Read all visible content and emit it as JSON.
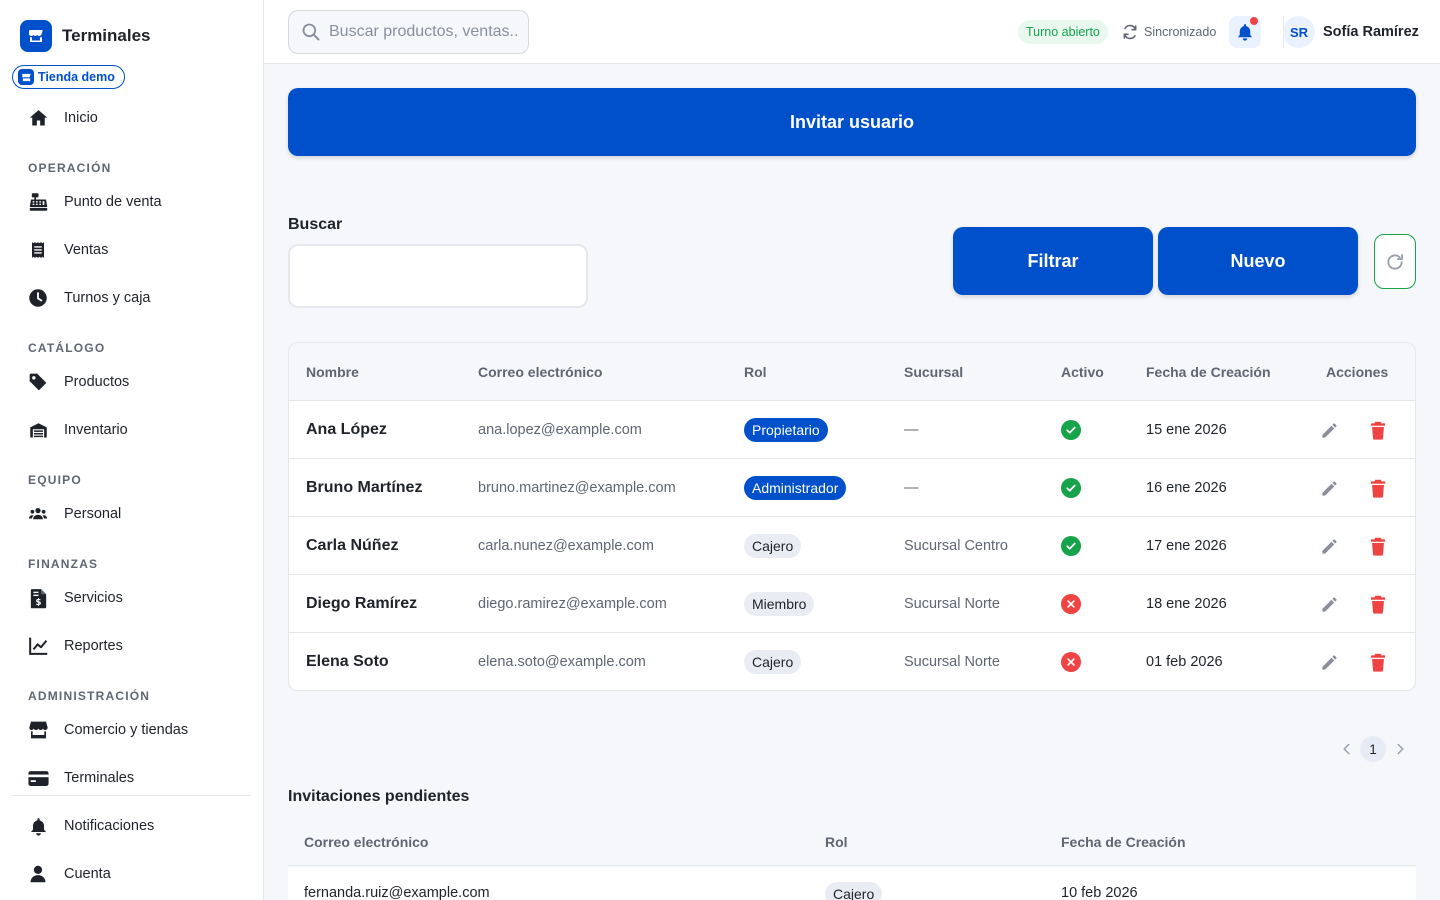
{
  "app": {
    "title": "Terminales",
    "store_badge": "Tienda demo"
  },
  "sidebar": {
    "home": "Inicio",
    "sections": {
      "operacion": "OPERACIÓN",
      "catalogo": "CATÁLOGO",
      "equipo": "EQUIPO",
      "finanzas": "FINANZAS",
      "administracion": "ADMINISTRACIÓN"
    },
    "items": {
      "pos": "Punto de venta",
      "ventas": "Ventas",
      "turnos": "Turnos y caja",
      "productos": "Productos",
      "inventario": "Inventario",
      "personal": "Personal",
      "servicios": "Servicios",
      "reportes": "Reportes",
      "comercio": "Comercio y tiendas",
      "terminales": "Terminales",
      "notificaciones": "Notificaciones",
      "cuenta": "Cuenta"
    }
  },
  "topbar": {
    "search_placeholder": "Buscar productos, ventas...",
    "shift_status": "Turno abierto",
    "sync_status": "Sincronizado",
    "user_initials": "SR",
    "user_name": "Sofía Ramírez"
  },
  "main": {
    "invite_button": "Invitar usuario",
    "search_label": "Buscar",
    "search_value": "",
    "filter_button": "Filtrar",
    "new_button": "Nuevo"
  },
  "users_table": {
    "headers": {
      "name": "Nombre",
      "email": "Correo electrónico",
      "role": "Rol",
      "branch": "Sucursal",
      "active": "Activo",
      "created": "Fecha de Creación",
      "actions": "Acciones"
    },
    "rows": [
      {
        "name": "Ana López",
        "email": "ana.lopez@example.com",
        "role": "Propietario",
        "role_style": "primary",
        "branch": "—",
        "active": true,
        "created": "15 ene 2026"
      },
      {
        "name": "Bruno Martínez",
        "email": "bruno.martinez@example.com",
        "role": "Administrador",
        "role_style": "primary",
        "branch": "—",
        "active": true,
        "created": "16 ene 2026"
      },
      {
        "name": "Carla Núñez",
        "email": "carla.nunez@example.com",
        "role": "Cajero",
        "role_style": "muted",
        "branch": "Sucursal Centro",
        "active": true,
        "created": "17 ene 2026"
      },
      {
        "name": "Diego Ramírez",
        "email": "diego.ramirez@example.com",
        "role": "Miembro",
        "role_style": "muted",
        "branch": "Sucursal Norte",
        "active": false,
        "created": "18 ene 2026"
      },
      {
        "name": "Elena Soto",
        "email": "elena.soto@example.com",
        "role": "Cajero",
        "role_style": "muted",
        "branch": "Sucursal Norte",
        "active": false,
        "created": "01 feb 2026"
      }
    ]
  },
  "pagination": {
    "current_page": "1"
  },
  "invitations": {
    "title": "Invitaciones pendientes",
    "headers": {
      "email": "Correo electrónico",
      "role": "Rol",
      "created": "Fecha de Creación"
    },
    "rows": [
      {
        "email": "fernanda.ruiz@example.com",
        "role": "Cajero",
        "created": "10 feb 2026"
      }
    ]
  },
  "colors": {
    "primary": "#0050cc",
    "success": "#16a34a",
    "danger": "#ef4444",
    "muted_text": "#5f6672",
    "background": "#f5f7fa"
  },
  "icons": {
    "brand": "store-icon",
    "home": "home-icon",
    "pos": "cash-register-icon",
    "ventas": "receipt-icon",
    "turnos": "clock-icon",
    "productos": "tag-icon",
    "inventario": "warehouse-icon",
    "personal": "users-icon",
    "servicios": "invoice-dollar-icon",
    "reportes": "chart-line-icon",
    "comercio": "store-icon",
    "terminales": "credit-card-icon",
    "notificaciones": "bell-icon",
    "cuenta": "user-icon",
    "edit": "pencil-icon",
    "delete": "trash-icon",
    "active": "check-circle-icon",
    "inactive": "x-circle-icon",
    "refresh": "refresh-icon",
    "sync": "sync-icon",
    "search": "search-icon"
  }
}
